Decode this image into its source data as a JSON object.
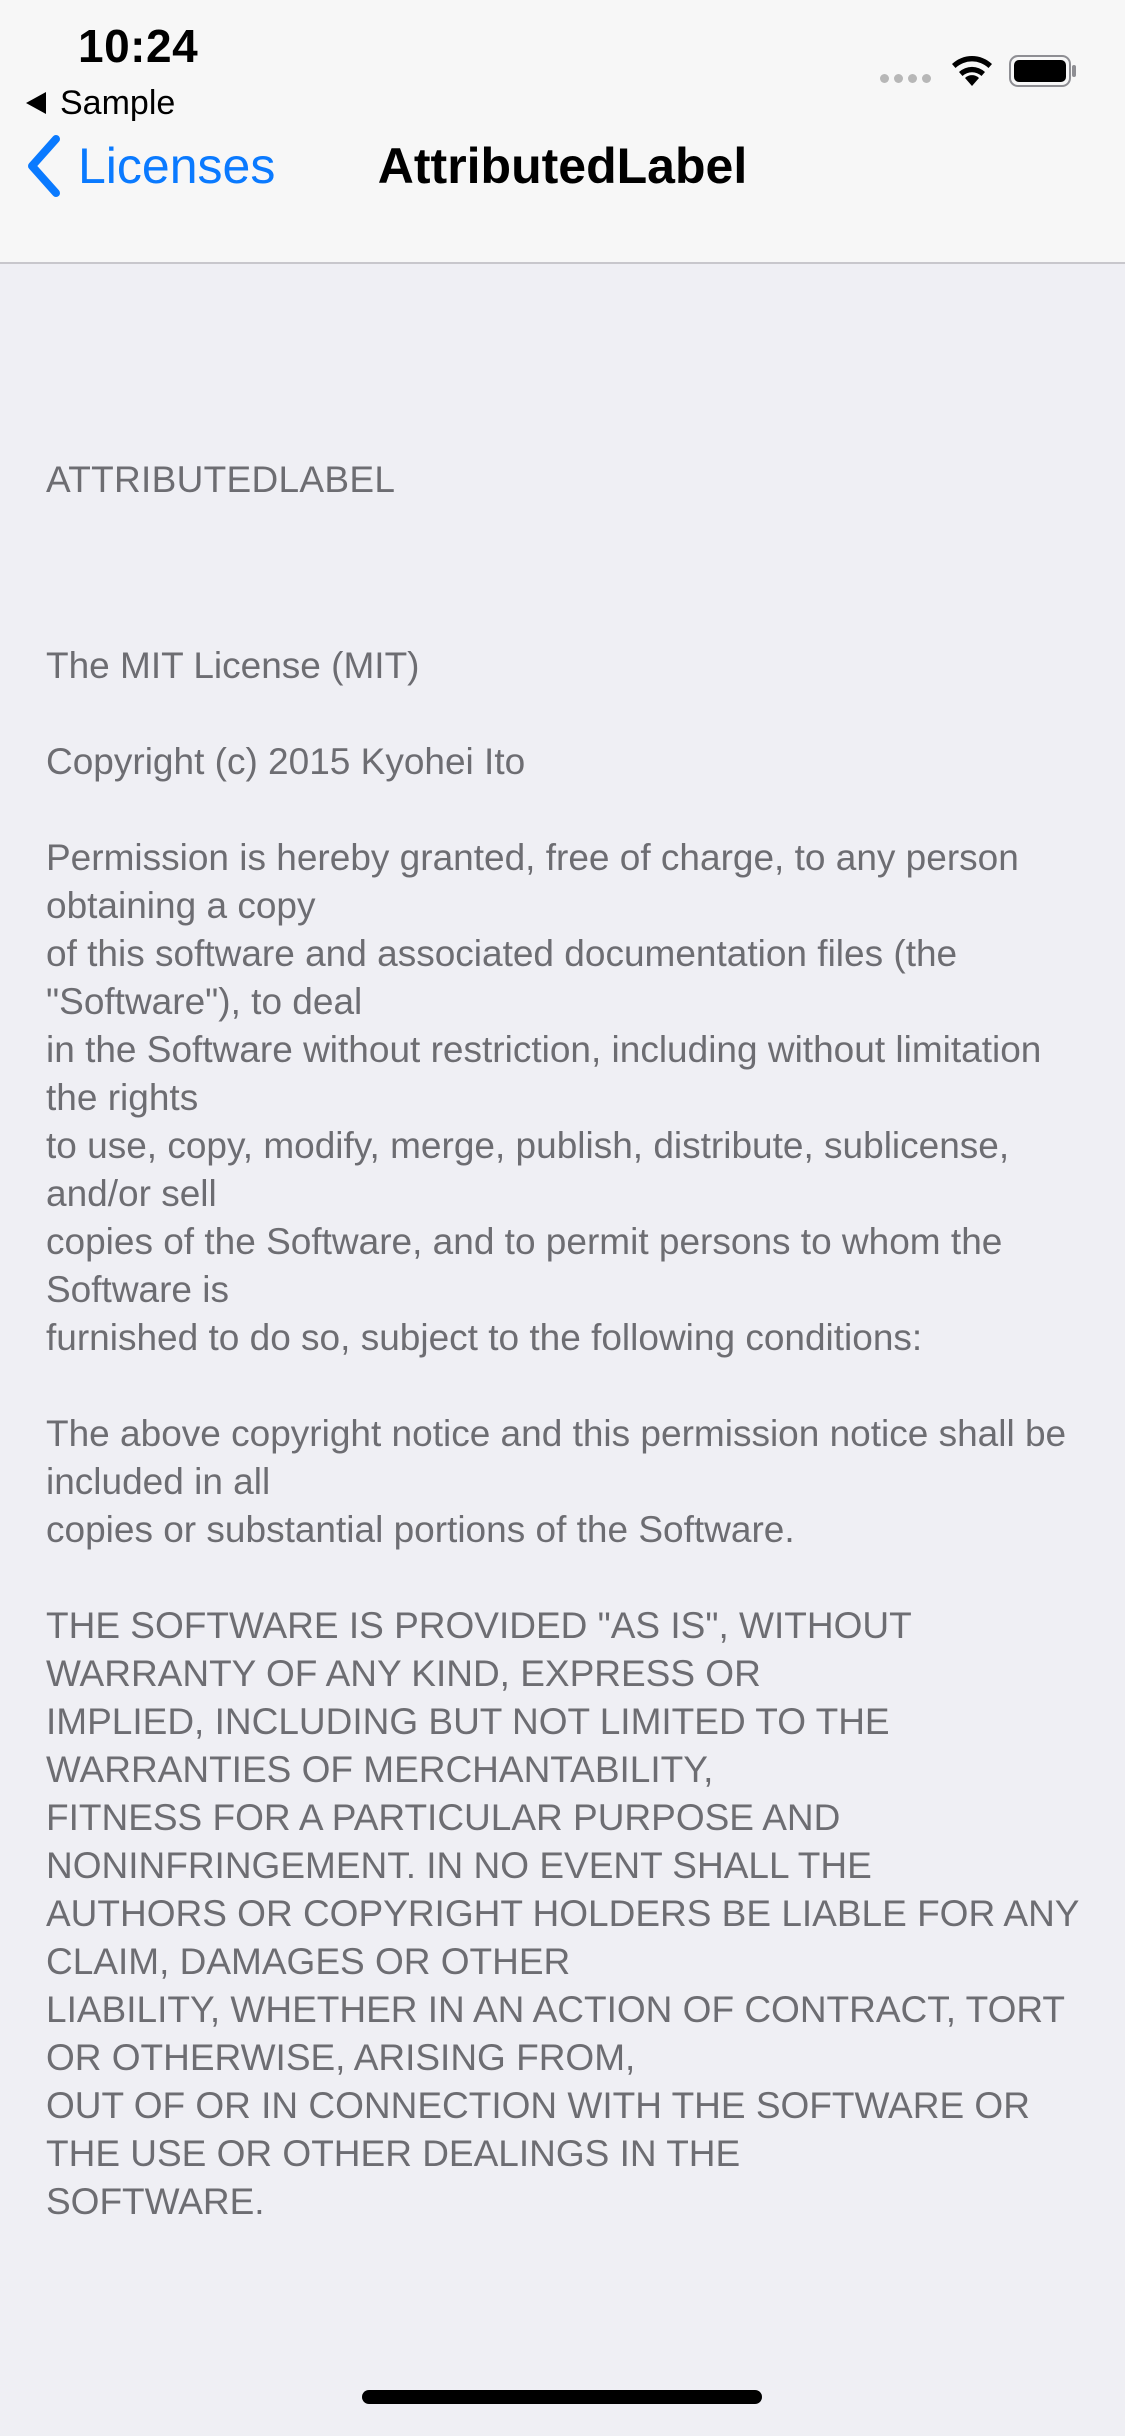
{
  "status_bar": {
    "time": "10:24",
    "back_app_label": "Sample"
  },
  "nav_bar": {
    "back_label": "Licenses",
    "title": "AttributedLabel"
  },
  "license": {
    "name": "ATTRIBUTEDLABEL",
    "text": "The MIT License (MIT)\n\nCopyright (c) 2015 Kyohei Ito\n\nPermission is hereby granted, free of charge, to any person obtaining a copy\nof this software and associated documentation files (the \"Software\"), to deal\nin the Software without restriction, including without limitation the rights\nto use, copy, modify, merge, publish, distribute, sublicense, and/or sell\ncopies of the Software, and to permit persons to whom the Software is\nfurnished to do so, subject to the following conditions:\n\nThe above copyright notice and this permission notice shall be included in all\ncopies or substantial portions of the Software.\n\nTHE SOFTWARE IS PROVIDED \"AS IS\", WITHOUT WARRANTY OF ANY KIND, EXPRESS OR\nIMPLIED, INCLUDING BUT NOT LIMITED TO THE WARRANTIES OF MERCHANTABILITY,\nFITNESS FOR A PARTICULAR PURPOSE AND NONINFRINGEMENT. IN NO EVENT SHALL THE\nAUTHORS OR COPYRIGHT HOLDERS BE LIABLE FOR ANY CLAIM, DAMAGES OR OTHER\nLIABILITY, WHETHER IN AN ACTION OF CONTRACT, TORT OR OTHERWISE, ARISING FROM,\nOUT OF OR IN CONNECTION WITH THE SOFTWARE OR THE USE OR OTHER DEALINGS IN THE\nSOFTWARE."
  },
  "icons": {
    "back_app": "back-triangle-icon",
    "signal": "cellular-signal-icon",
    "wifi": "wifi-icon",
    "battery": "battery-icon",
    "nav_back": "chevron-left-icon"
  },
  "colors": {
    "accent": "#0a7aff",
    "background": "#efeff4",
    "nav_background": "#f7f7f7",
    "body_text": "#6d6d72"
  }
}
